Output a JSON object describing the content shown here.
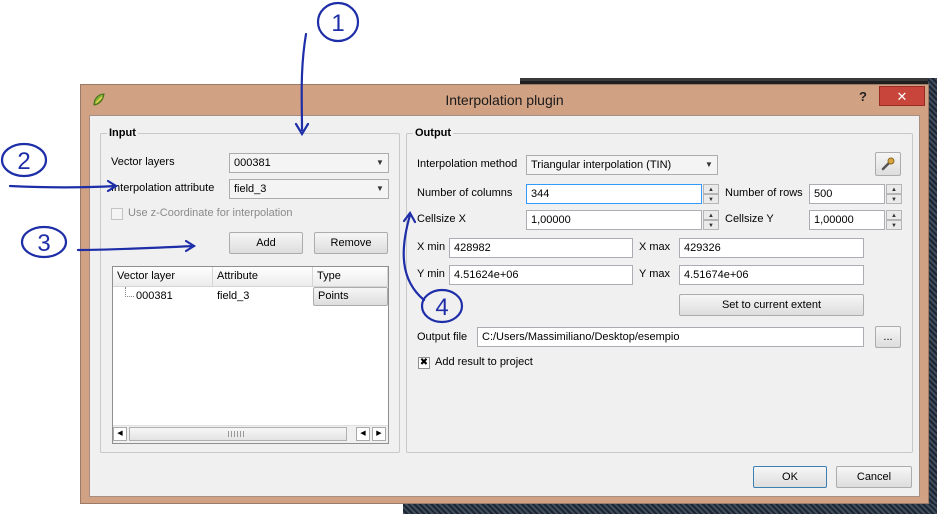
{
  "dialog": {
    "title": "Interpolation plugin",
    "help": "?",
    "close": "✕"
  },
  "input": {
    "title": "Input",
    "vector_layers_label": "Vector layers",
    "vector_layers_value": "000381",
    "attribute_label": "Interpolation attribute",
    "attribute_value": "field_3",
    "zcoord_label": "Use z-Coordinate for interpolation",
    "add": "Add",
    "remove": "Remove",
    "table": {
      "columns": [
        "Vector layer",
        "Attribute",
        "Type"
      ],
      "rows": [
        {
          "layer": "000381",
          "attribute": "field_3",
          "type": "Points"
        }
      ]
    }
  },
  "output": {
    "title": "Output",
    "method_label": "Interpolation method",
    "method_value": "Triangular interpolation (TIN)",
    "columns_label": "Number of columns",
    "columns_value": "344",
    "rows_label": "Number of rows",
    "rows_value": "500",
    "cellx_label": "Cellsize X",
    "cellx_value": "1,00000",
    "celly_label": "Cellsize Y",
    "celly_value": "1,00000",
    "xmin_label": "X min",
    "xmin_value": "428982",
    "xmax_label": "X max",
    "xmax_value": "429326",
    "ymin_label": "Y min",
    "ymin_value": "4.51624e+06",
    "ymax_label": "Y max",
    "ymax_value": "4.51674e+06",
    "extent_button": "Set to current extent",
    "file_label": "Output file",
    "file_value": "C:/Users/Massimiliano/Desktop/esempio",
    "browse": "...",
    "add_result_label": "Add result to project",
    "add_result_mark": "✖"
  },
  "footer": {
    "ok": "OK",
    "cancel": "Cancel"
  },
  "annotations": [
    "1",
    "2",
    "3",
    "4"
  ]
}
